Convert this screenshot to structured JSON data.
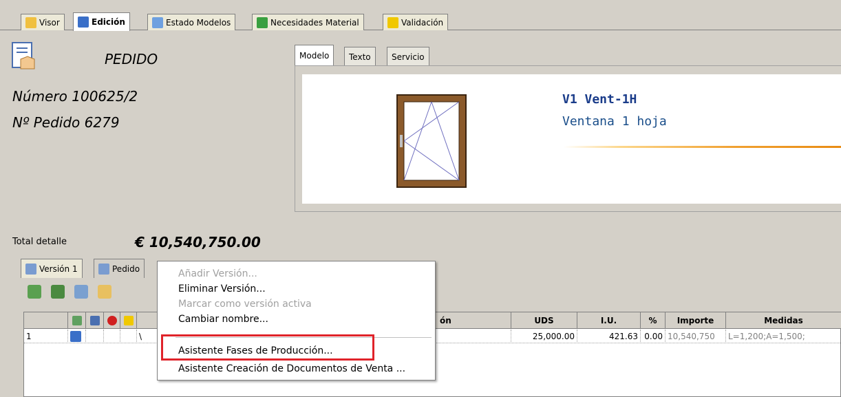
{
  "top_tabs": [
    {
      "label": "Visor",
      "icon": "viewer-icon",
      "active": false
    },
    {
      "label": "Edición",
      "icon": "grid-icon",
      "active": true
    },
    {
      "label": "Estado Modelos",
      "icon": "list-icon",
      "active": false
    },
    {
      "label": "Necesidades Material",
      "icon": "cube-icon",
      "active": false
    },
    {
      "label": "Validación",
      "icon": "warning-icon",
      "active": false
    }
  ],
  "order": {
    "title": "PEDIDO",
    "numero": "Número 100625/2",
    "num_pedido": "Nº Pedido 6279"
  },
  "model_tabs": [
    "Modelo",
    "Texto",
    "Servicio"
  ],
  "model": {
    "code": "V1  Vent-1H",
    "description": "Ventana 1 hoja"
  },
  "totals": {
    "label": "Total detalle",
    "value": "€ 10,540,750.00"
  },
  "bottom_tabs": [
    "Versión 1",
    "Pedido"
  ],
  "grid": {
    "headers": {
      "desc_tail": "ón",
      "uds": "UDS",
      "iu": "I.U.",
      "pct": "%",
      "importe": "Importe",
      "medidas": "Medidas"
    },
    "row": {
      "index": "1",
      "mark": "\\",
      "uds": "25,000.00",
      "iu": "421.63",
      "pct": "0.00",
      "importe": "10,540,750",
      "medidas": "L=1,200;A=1,500;"
    }
  },
  "context_menu": {
    "items": [
      {
        "label": "Añadir Versión...",
        "disabled": true
      },
      {
        "label": "Eliminar Versión...",
        "disabled": false
      },
      {
        "label": "Marcar como versión activa",
        "disabled": true
      },
      {
        "label": "Cambiar nombre...",
        "disabled": false
      },
      {
        "label": "Asistente Fases de Producción...",
        "disabled": false
      },
      {
        "label": "Asistente Creación de Documentos de Venta ...",
        "disabled": false
      }
    ]
  },
  "colors": {
    "highlight": "#e0232a",
    "model_text": "#1a3c8a",
    "accent_orange": "#e88a10"
  }
}
